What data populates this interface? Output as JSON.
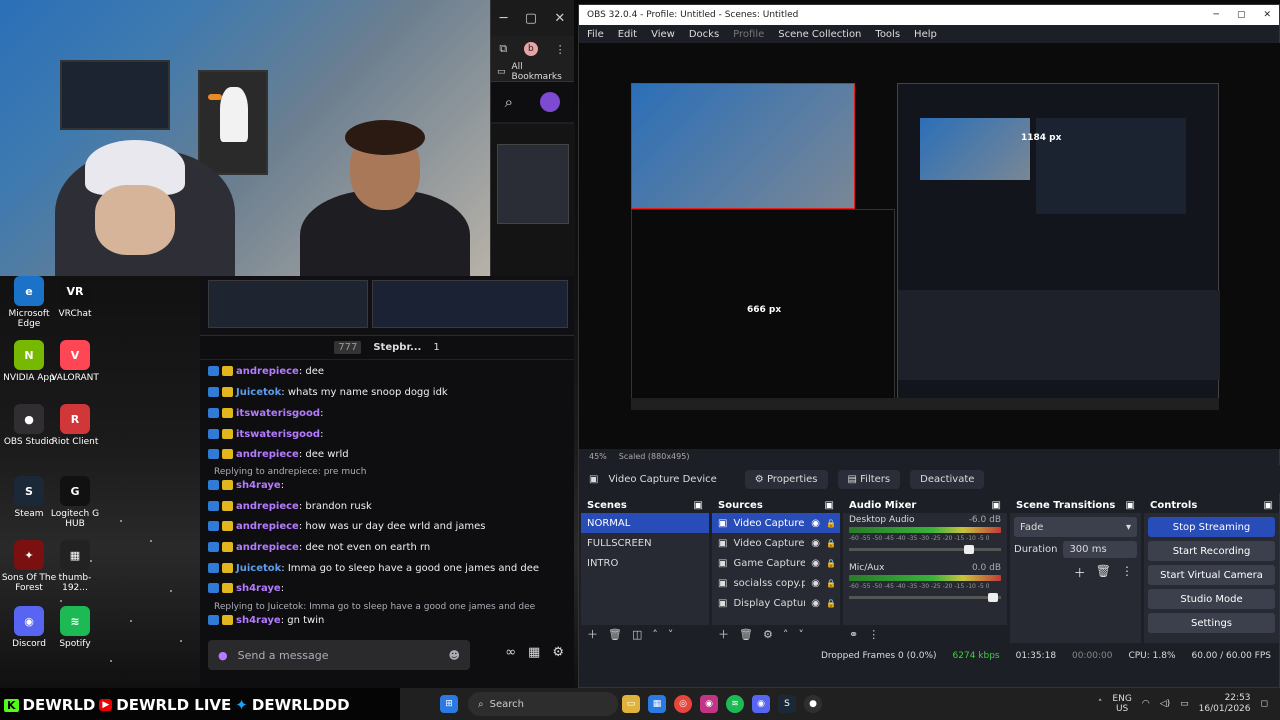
{
  "desktop": {
    "icons": [
      {
        "label": "Microsoft Edge",
        "glyph": "e",
        "color": "#1a73c8"
      },
      {
        "label": "VRChat",
        "glyph": "VR",
        "color": "#111111"
      },
      {
        "label": "NVIDIA App",
        "glyph": "N",
        "color": "#76b900"
      },
      {
        "label": "VALORANT",
        "glyph": "V",
        "color": "#ff4655"
      },
      {
        "label": "OBS Studio",
        "glyph": "●",
        "color": "#302e31"
      },
      {
        "label": "Riot Client",
        "glyph": "R",
        "color": "#d13639"
      },
      {
        "label": "Steam",
        "glyph": "S",
        "color": "#1b2838"
      },
      {
        "label": "Logitech G HUB",
        "glyph": "G",
        "color": "#111111"
      },
      {
        "label": "Sons Of The Forest",
        "glyph": "✦",
        "color": "#7a1010"
      },
      {
        "label": "thumb-192...",
        "glyph": "▦",
        "color": "#222222"
      },
      {
        "label": "Discord",
        "glyph": "◉",
        "color": "#5865f2"
      },
      {
        "label": "Spotify",
        "glyph": "≋",
        "color": "#1db954"
      }
    ]
  },
  "chrome": {
    "bookmarks_label": "All Bookmarks",
    "profile_initial": "b"
  },
  "chat": {
    "header_count": "777",
    "header_stream": "Stepbr...",
    "header_viewers": "1",
    "messages": [
      {
        "user": "andrepiece",
        "text": ": dee",
        "color": "#b57bff"
      },
      {
        "user": "Juicetok",
        "text": ": whats my name snoop dogg idk",
        "color": "#5c9ded"
      },
      {
        "user": "itswaterisgood",
        "text": ":",
        "color": "#b57bff"
      },
      {
        "user": "itswaterisgood",
        "text": ":",
        "color": "#b57bff"
      },
      {
        "user": "andrepiece",
        "text": ": dee wrld",
        "color": "#b57bff"
      },
      {
        "user": "sh4raye",
        "text": ":",
        "color": "#b57bff"
      },
      {
        "user": "andrepiece",
        "text": ": brandon rusk",
        "color": "#b57bff"
      },
      {
        "user": "andrepiece",
        "text": ": how was ur day dee wrld and james",
        "color": "#b57bff"
      },
      {
        "user": "andrepiece",
        "text": ": dee not even on earth rn",
        "color": "#b57bff"
      },
      {
        "user": "Juicetok",
        "text": ": Imma go to sleep have a good one james and dee",
        "color": "#5c9ded"
      },
      {
        "user": "sh4raye",
        "text": ":",
        "color": "#b57bff"
      },
      {
        "user": "sh4raye",
        "text": ": gn twin",
        "color": "#b57bff"
      }
    ],
    "reply1": "Replying to andrepiece: pre much",
    "reply2": "Replying to Juicetok: Imma go to sleep have a good one james and dee",
    "input_placeholder": "Send a message"
  },
  "obs": {
    "title": "OBS 32.0.4 - Profile: Untitled - Scenes: Untitled",
    "menu": [
      "File",
      "Edit",
      "View",
      "Docks",
      "Profile",
      "Scene Collection",
      "Tools",
      "Help"
    ],
    "preview_label_1184": "1184 px",
    "preview_label_666": "666 px",
    "zoom": "45%",
    "scaled": "Scaled (880x495)",
    "source_name": "Video Capture Device",
    "properties_label": "Properties",
    "filters_label": "Filters",
    "deactivate_label": "Deactivate",
    "scenes_title": "Scenes",
    "scenes": [
      "NORMAL",
      "FULLSCREEN",
      "INTRO"
    ],
    "sources_title": "Sources",
    "sources": [
      "Video Capture De",
      "Video Capture De",
      "Game Capture",
      "socialss copy.png",
      "Display Capture"
    ],
    "mixer_title": "Audio Mixer",
    "mixer": [
      {
        "name": "Desktop Audio",
        "db": "-6.0 dB",
        "level": 0.82
      },
      {
        "name": "Mic/Aux",
        "db": "0.0 dB",
        "level": 0.98
      }
    ],
    "meter_scale": "-60 -55 -50 -45 -40 -35 -30 -25 -20 -15 -10 -5 0",
    "transitions_title": "Scene Transitions",
    "transition_type": "Fade",
    "duration_label": "Duration",
    "duration_value": "300 ms",
    "controls_title": "Controls",
    "controls": [
      "Stop Streaming",
      "Start Recording",
      "Start Virtual Camera",
      "Studio Mode",
      "Settings"
    ],
    "status": {
      "dropped": "Dropped Frames 0 (0.0%)",
      "bitrate": "6274 kbps",
      "stream_time": "01:35:18",
      "rec_time": "00:00:00",
      "cpu": "CPU: 1.8%",
      "fps": "60.00 / 60.00 FPS"
    }
  },
  "banner": {
    "texts": [
      "DEWRLD",
      "DEWRLD LIVE",
      "DEWRLDDD"
    ]
  },
  "taskbar": {
    "search_placeholder": "Search",
    "lang": "ENG",
    "region": "US",
    "time": "22:53",
    "date": "16/01/2026"
  }
}
